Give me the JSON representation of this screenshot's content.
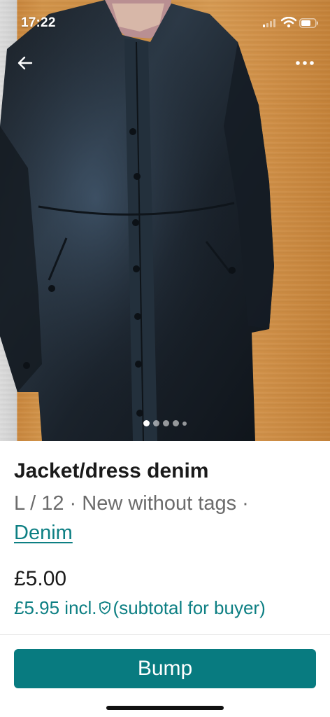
{
  "status_bar": {
    "time": "17:22"
  },
  "photo": {
    "description_icon": "leather-jacket-dress-photo",
    "carousel": {
      "total": 5,
      "active_index": 0
    }
  },
  "item": {
    "title": "Jacket/dress denim",
    "size_condition": "L / 12 · New without tags ·",
    "brand": "Denim",
    "price": "£5.00",
    "price_incl": "£5.95 incl.",
    "subtotal_note": "(subtotal for buyer)"
  },
  "actions": {
    "bump_label": "Bump"
  },
  "colors": {
    "accent": "#087b80",
    "link": "#0d7f83"
  },
  "icons": {
    "back": "back-arrow-icon",
    "more": "more-options-icon",
    "shield": "buyer-protection-shield-icon"
  }
}
